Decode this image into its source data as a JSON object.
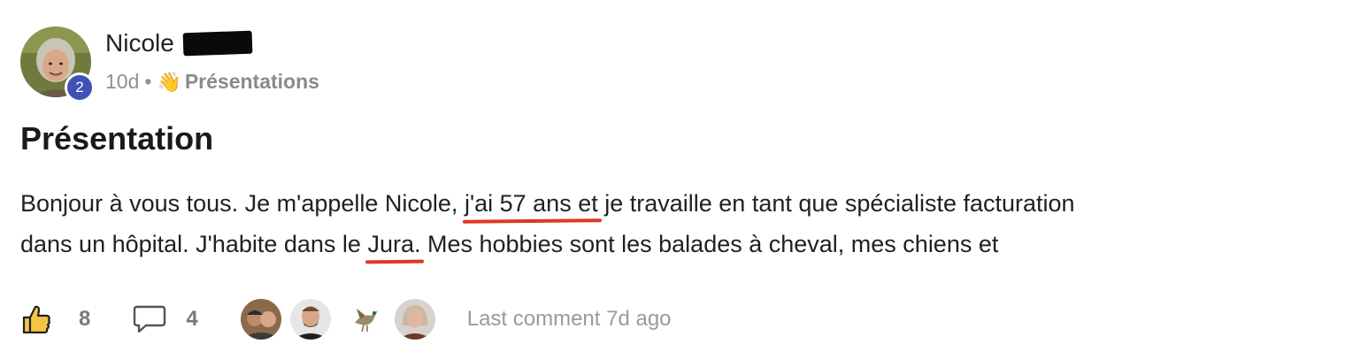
{
  "post": {
    "author": {
      "name": "Nicole",
      "level": "2"
    },
    "meta": {
      "time": "10d",
      "separator": "•",
      "category_emoji": "👋",
      "category": "Présentations"
    },
    "title": "Présentation",
    "body": {
      "line1_a": "Bonjour à vous tous. Je m'appelle Nicole,",
      "line1_mark": "j'ai 57 ans et",
      "line1_b": "je travaille en tant que spécialiste facturation",
      "line2_a": "dans un hôpital. J'habite dans le",
      "line2_mark": "Jura.",
      "line2_b": "Mes hobbies sont les balades à cheval, mes chiens et"
    },
    "footer": {
      "likes": "8",
      "comments": "4",
      "last_comment": "Last comment 7d ago"
    }
  },
  "colors": {
    "badge": "#3f51b5",
    "underline_annotation": "#e0371f",
    "muted_text": "#909090"
  },
  "icons": {
    "like": "thumbs-up-icon",
    "comment": "speech-bubble-icon"
  }
}
